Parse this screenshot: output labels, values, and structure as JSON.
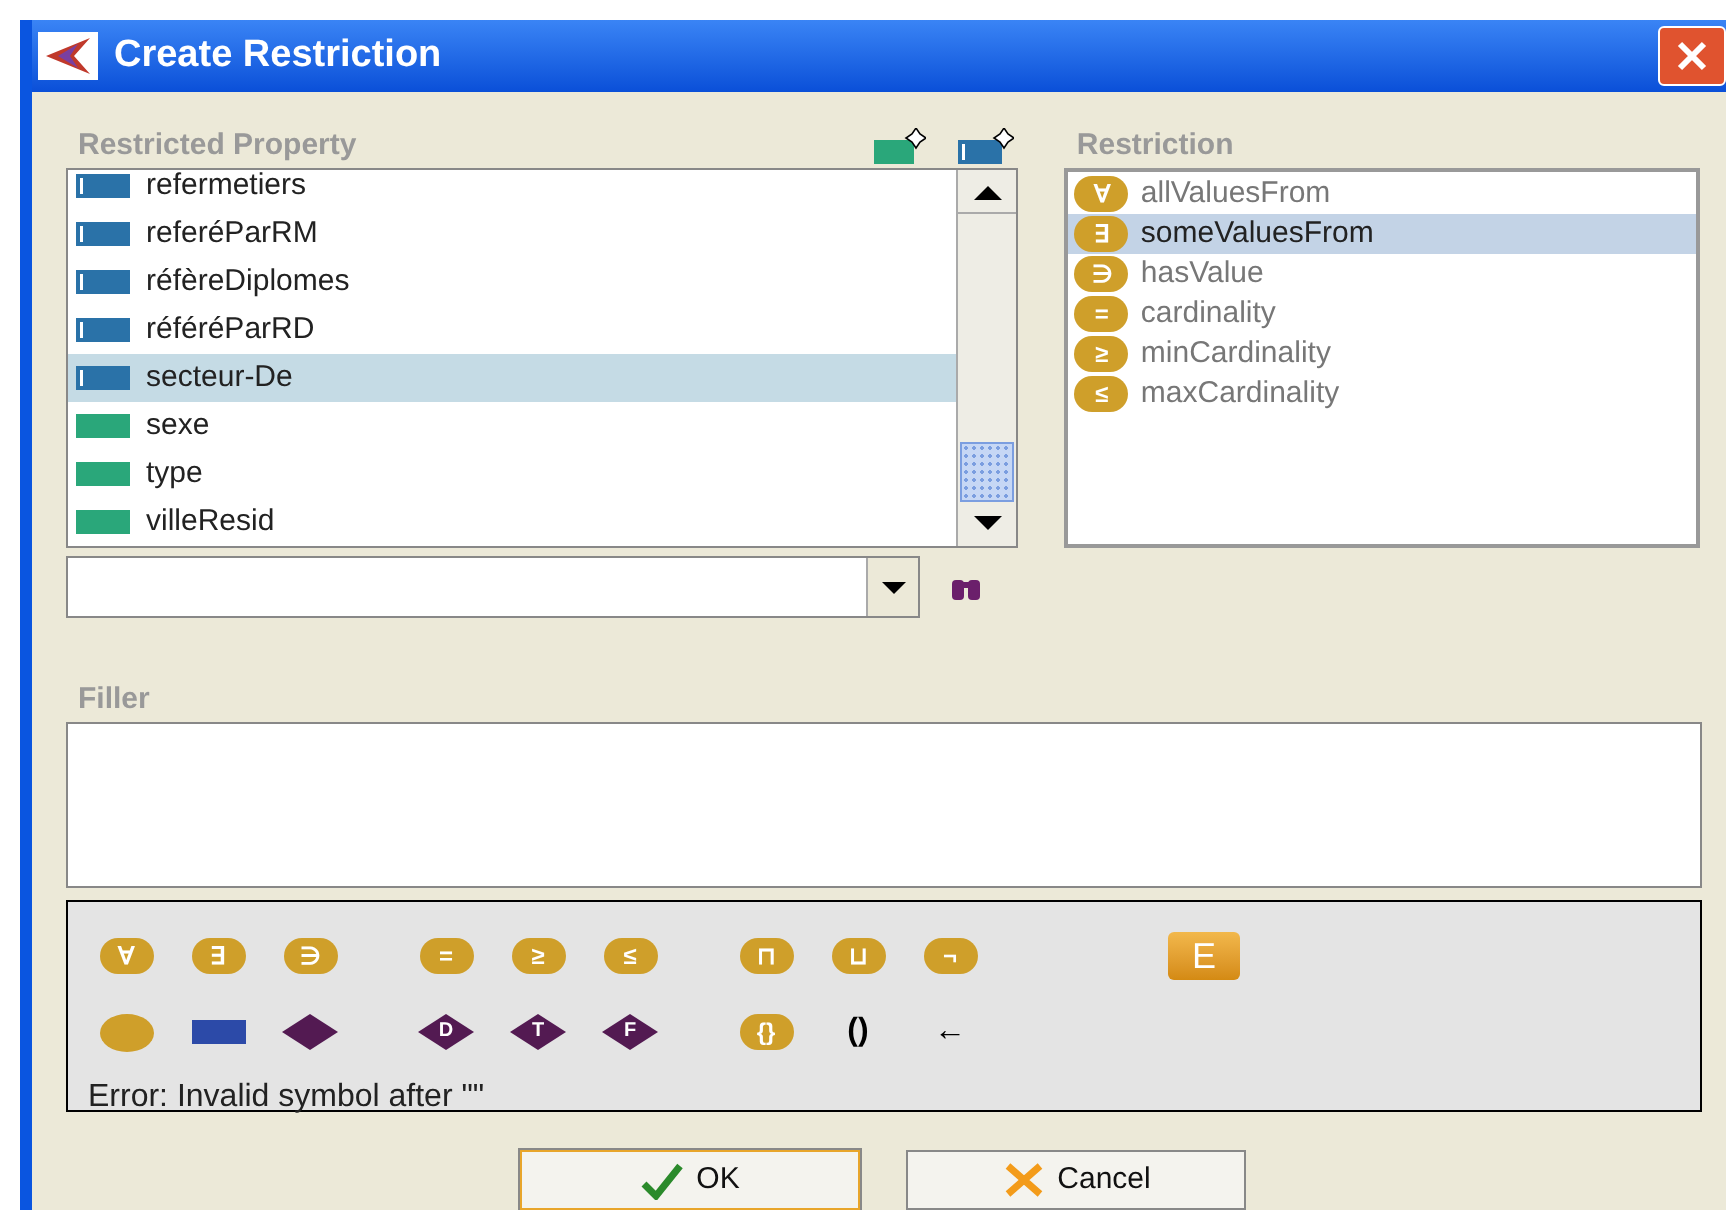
{
  "window": {
    "title": "Create Restriction"
  },
  "restricted_property": {
    "label": "Restricted Property",
    "items": [
      {
        "name": "refermetiers",
        "kind": "object",
        "selected": false
      },
      {
        "name": "referéParRM",
        "kind": "object",
        "selected": false
      },
      {
        "name": "réfèreDiplomes",
        "kind": "object",
        "selected": false
      },
      {
        "name": "référéParRD",
        "kind": "object",
        "selected": false
      },
      {
        "name": "secteur-De",
        "kind": "object",
        "selected": true
      },
      {
        "name": "sexe",
        "kind": "datatype",
        "selected": false
      },
      {
        "name": "type",
        "kind": "datatype",
        "selected": false
      },
      {
        "name": "villeResid",
        "kind": "datatype",
        "selected": false
      }
    ]
  },
  "restriction": {
    "label": "Restriction",
    "items": [
      {
        "symbol": "∀",
        "name": "allValuesFrom",
        "selected": false
      },
      {
        "symbol": "∃",
        "name": "someValuesFrom",
        "selected": true
      },
      {
        "symbol": "∋",
        "name": "hasValue",
        "selected": false
      },
      {
        "symbol": "=",
        "name": "cardinality",
        "selected": false
      },
      {
        "symbol": "≥",
        "name": "minCardinality",
        "selected": false
      },
      {
        "symbol": "≤",
        "name": "maxCardinality",
        "selected": false
      }
    ]
  },
  "filler": {
    "label": "Filler"
  },
  "palette": {
    "rows": [
      {
        "groups": [
          [
            {
              "kind": "circle",
              "symbol": "∀"
            },
            {
              "kind": "circle",
              "symbol": "∃"
            },
            {
              "kind": "circle",
              "symbol": "∋"
            }
          ],
          [
            {
              "kind": "circle",
              "symbol": "="
            },
            {
              "kind": "circle",
              "symbol": "≥"
            },
            {
              "kind": "circle",
              "symbol": "≤"
            }
          ],
          [
            {
              "kind": "circle",
              "symbol": "⊓"
            },
            {
              "kind": "circle",
              "symbol": "⊔"
            },
            {
              "kind": "circle",
              "symbol": "¬"
            }
          ],
          [
            {
              "kind": "square",
              "symbol": "E"
            }
          ]
        ]
      },
      {
        "groups": [
          [
            {
              "kind": "dot"
            },
            {
              "kind": "bar"
            },
            {
              "kind": "diamond"
            }
          ],
          [
            {
              "kind": "diamond",
              "symbol": "D"
            },
            {
              "kind": "diamond",
              "symbol": "T"
            },
            {
              "kind": "diamond",
              "symbol": "F"
            }
          ],
          [
            {
              "kind": "circle",
              "symbol": "{}"
            },
            {
              "kind": "plain",
              "symbol": "()"
            },
            {
              "kind": "plain",
              "symbol": "←"
            }
          ]
        ]
      }
    ],
    "message": "Error: Invalid symbol after \"\""
  },
  "buttons": [
    {
      "label": "OK",
      "kind": "ok"
    },
    {
      "label": "Cancel",
      "kind": "cancel"
    }
  ]
}
